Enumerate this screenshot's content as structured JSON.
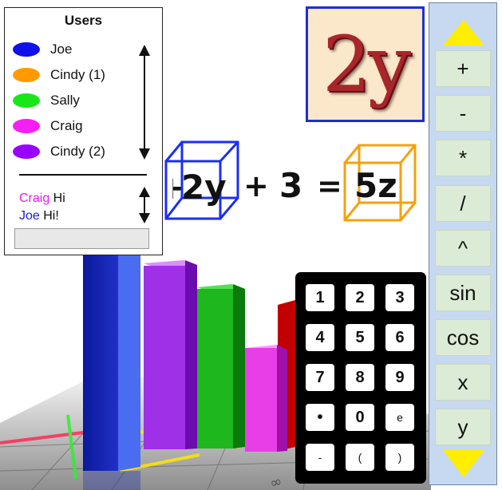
{
  "users_panel": {
    "title": "Users",
    "users": [
      {
        "name": "Joe",
        "color": "#1010e8"
      },
      {
        "name": "Cindy (1)",
        "color": "#ff9a00"
      },
      {
        "name": "Sally",
        "color": "#19e619"
      },
      {
        "name": "Craig",
        "color": "#f51ef5"
      },
      {
        "name": "Cindy (2)",
        "color": "#9a00ff"
      }
    ],
    "chat": [
      {
        "sender": "Craig",
        "sender_color": "#ee18ee",
        "message": " Hi"
      },
      {
        "sender": "Joe",
        "sender_color": "#1a1adb",
        "message": " Hi!"
      }
    ],
    "chat_input_value": ""
  },
  "tile": {
    "label": "2y"
  },
  "equation": {
    "parts": [
      {
        "text": "+"
      },
      {
        "text": "2y"
      },
      {
        "text": "+"
      },
      {
        "text": "3"
      },
      {
        "text": "="
      },
      {
        "text": "5z"
      }
    ],
    "cube_colors": {
      "left": "#1b2ff0",
      "right": "#f5a10e"
    }
  },
  "keypad": {
    "keys": [
      "1",
      "2",
      "3",
      "4",
      "5",
      "6",
      "7",
      "8",
      "9",
      "•",
      "0",
      "e",
      "-",
      "(",
      ")"
    ]
  },
  "operators": {
    "buttons": [
      "+",
      "-",
      "*",
      "/",
      "^",
      "sin",
      "cos",
      "x",
      "y"
    ],
    "arrow_color": "#ffee00"
  }
}
